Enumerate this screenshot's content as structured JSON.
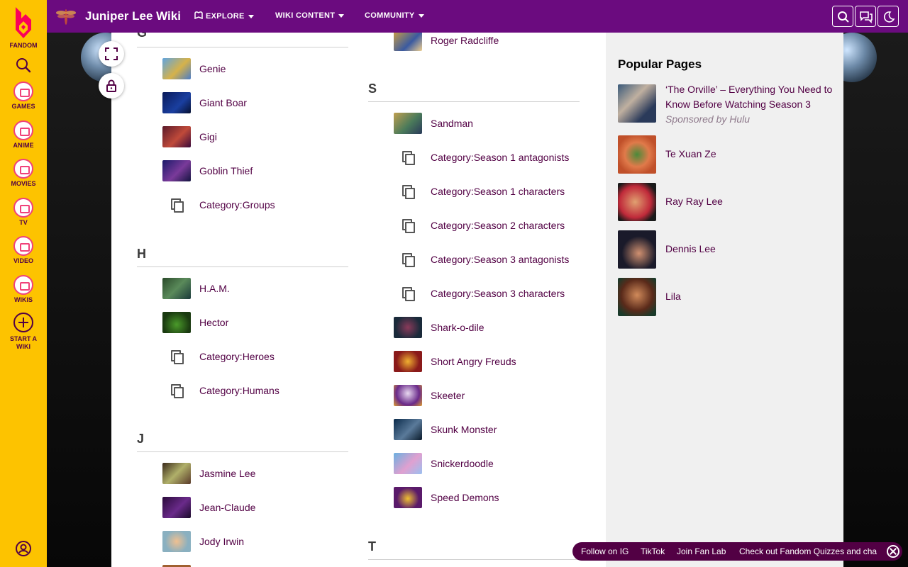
{
  "fandom_rail": {
    "logo_label": "FANDOM",
    "items": [
      {
        "label": "GAMES",
        "icon": "games-icon"
      },
      {
        "label": "ANIME",
        "icon": "anime-icon"
      },
      {
        "label": "MOVIES",
        "icon": "movies-icon"
      },
      {
        "label": "TV",
        "icon": "tv-icon"
      },
      {
        "label": "VIDEO",
        "icon": "video-icon"
      },
      {
        "label": "WIKIS",
        "icon": "wikis-icon"
      }
    ],
    "start_wiki": {
      "line1": "START A",
      "line2": "WIKI"
    }
  },
  "header": {
    "wiki_name": "Juniper Lee Wiki",
    "nav": [
      {
        "label": "EXPLORE"
      },
      {
        "label": "WIKI CONTENT"
      },
      {
        "label": "COMMUNITY"
      }
    ]
  },
  "sections": {
    "g": {
      "letter": "G",
      "entries": [
        "Genie",
        "Giant Boar",
        "Gigi",
        "Goblin Thief",
        "Category:Groups"
      ]
    },
    "h": {
      "letter": "H",
      "entries": [
        "H.A.M.",
        "Hector",
        "Category:Heroes",
        "Category:Humans"
      ]
    },
    "j": {
      "letter": "J",
      "entries": [
        "Jasmine Lee",
        "Jean-Claude",
        "Jody Irwin"
      ]
    },
    "r": {
      "entries": [
        "Roger Radcliffe"
      ]
    },
    "s": {
      "letter": "S",
      "entries": [
        "Sandman",
        "Category:Season 1 antagonists",
        "Category:Season 1 characters",
        "Category:Season 2 characters",
        "Category:Season 3 antagonists",
        "Category:Season 3 characters",
        "Shark-o-dile",
        "Short Angry Freuds",
        "Skeeter",
        "Skunk Monster",
        "Snickerdoodle",
        "Speed Demons"
      ]
    },
    "t": {
      "letter": "T"
    }
  },
  "popular_pages": {
    "title": "Popular Pages",
    "items": [
      {
        "title": "‘The Orville’ – Everything You Need to Know Before Watching Season 3",
        "sponsor": "Sponsored by Hulu"
      },
      {
        "title": "Te Xuan Ze"
      },
      {
        "title": "Ray Ray Lee"
      },
      {
        "title": "Dennis Lee"
      },
      {
        "title": "Lila"
      }
    ]
  },
  "bottom_bar": {
    "items": [
      "Follow on IG",
      "TikTok",
      "Join Fan Lab",
      "Check out Fandom Quizzes and cha"
    ]
  },
  "colors": {
    "rail": "#fdc300",
    "topbar": "#6b0b7f",
    "link": "#520044"
  }
}
